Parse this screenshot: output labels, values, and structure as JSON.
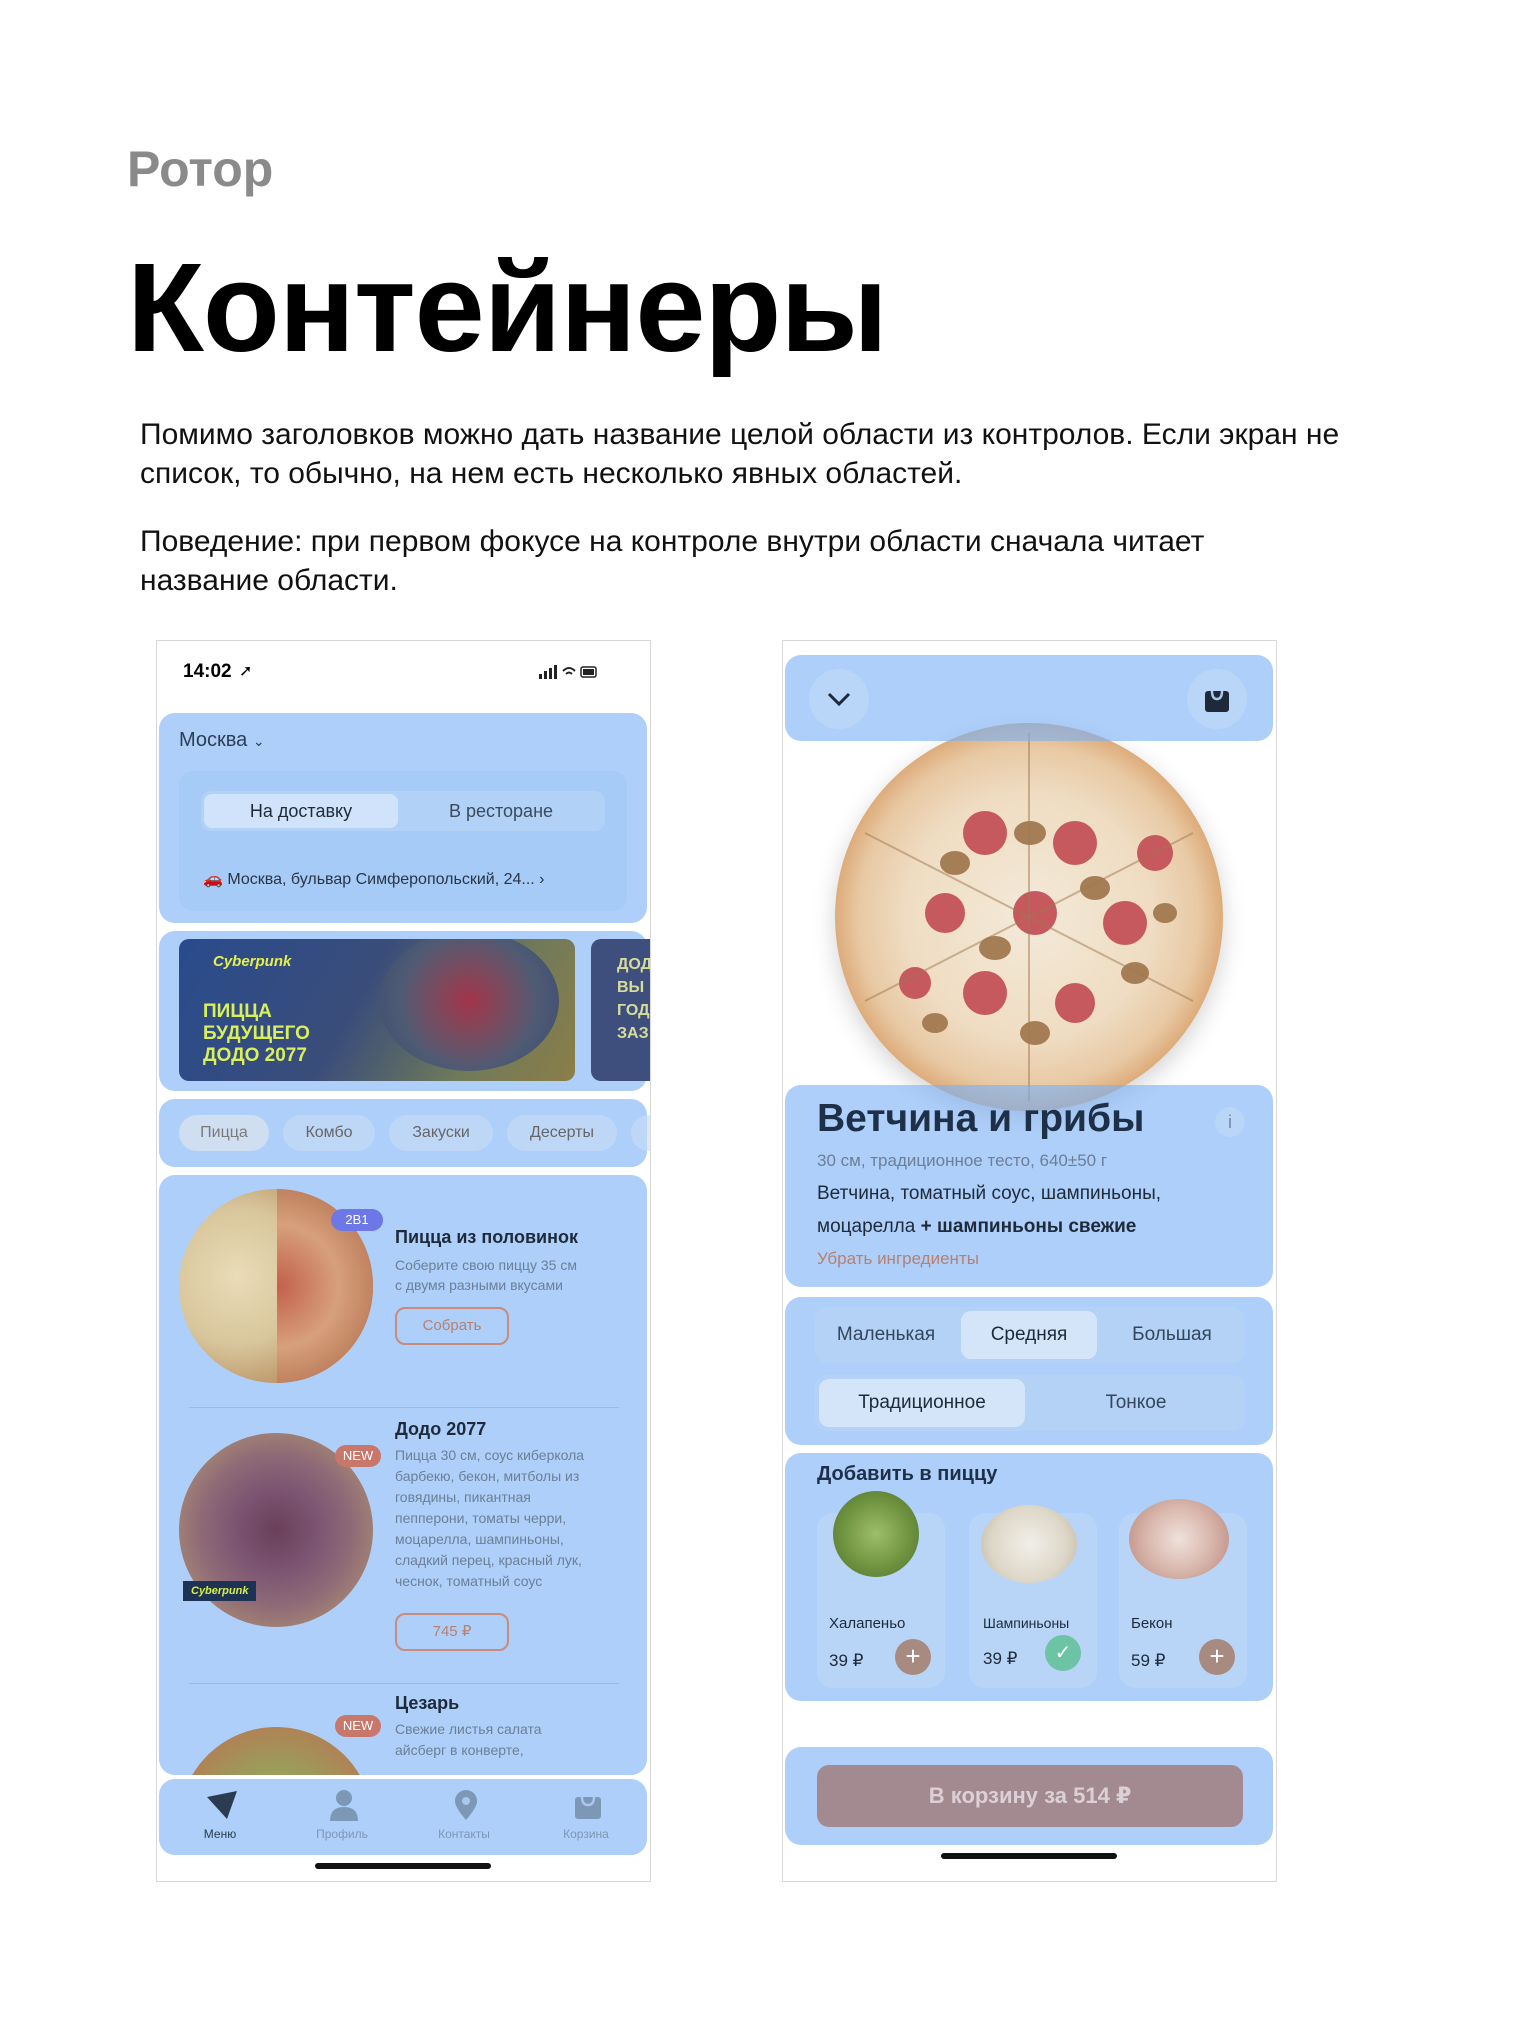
{
  "page": {
    "eyebrow": "Ротор",
    "title": "Контейнеры",
    "paragraph1": "Помимо заголовков можно дать название целой области из контролов. Если экран не список, то обычно, на нем есть несколько явных областей.",
    "paragraph2": "Поведение: при первом фокусе на контроле внутри области сначала читает название области."
  },
  "phone1": {
    "status_time": "14:02",
    "city": "Москва",
    "delivery_tabs": [
      "На доставку",
      "В ресторане"
    ],
    "address": "Москва, бульвар Симферопольский, 24...",
    "banner": {
      "logo": "Cyberpunk",
      "text_lines": [
        "ПИЦЦА",
        "БУДУЩЕГО",
        "ДОДО 2077"
      ],
      "next_text_lines": [
        "ДОД",
        "ВЫ",
        "ГОД",
        "ЗАЗ"
      ]
    },
    "categories": [
      "Пицца",
      "Комбо",
      "Закуски",
      "Десерты"
    ],
    "products": [
      {
        "name": "Пицца из половинок",
        "badge": "2В1",
        "desc": [
          "Соберите свою пиццу 35 см",
          "с двумя разными вкусами"
        ],
        "button": "Собрать"
      },
      {
        "name": "Додо 2077",
        "badge": "NEW",
        "sticker": "Cyberpunk",
        "desc": [
          "Пицца 30 см, соус киберкола",
          "барбекю, бекон, митболы из",
          "говядины, пикантная",
          "пепперони, томаты черри,",
          "моцарелла, шампиньоны,",
          "сладкий перец, красный лук,",
          "чеснок, томатный соус"
        ],
        "button": "745 ₽"
      },
      {
        "name": "Цезарь",
        "badge": "NEW",
        "desc": [
          "Свежие листья салата",
          "айсберг в конверте,"
        ]
      }
    ],
    "tab_bar": [
      "Меню",
      "Профиль",
      "Контакты",
      "Корзина"
    ]
  },
  "phone2": {
    "product_name": "Ветчина и грибы",
    "info_glyph": "i",
    "spec": "30 см, традиционное тесто, 640±50 г",
    "ingredients_line1": "Ветчина, томатный соус, шампиньоны,",
    "ingredients_line2_plain": "моцарелла",
    "ingredients_line2_bold": "+ шампиньоны свежие",
    "remove_link": "Убрать ингредиенты",
    "sizes": [
      "Маленькая",
      "Средняя",
      "Большая"
    ],
    "selected_size": "Средняя",
    "dough": [
      "Традиционное",
      "Тонкое"
    ],
    "selected_dough": "Традиционное",
    "add_title": "Добавить в пиццу",
    "toppings": [
      {
        "name": "Халапеньо",
        "price": "39 ₽",
        "state": "add"
      },
      {
        "name": "Шампиньоны",
        "price": "39 ₽",
        "state": "added"
      },
      {
        "name": "Бекон",
        "price": "59 ₽",
        "state": "add"
      }
    ],
    "cart_button": "В корзину за 514 ₽"
  }
}
